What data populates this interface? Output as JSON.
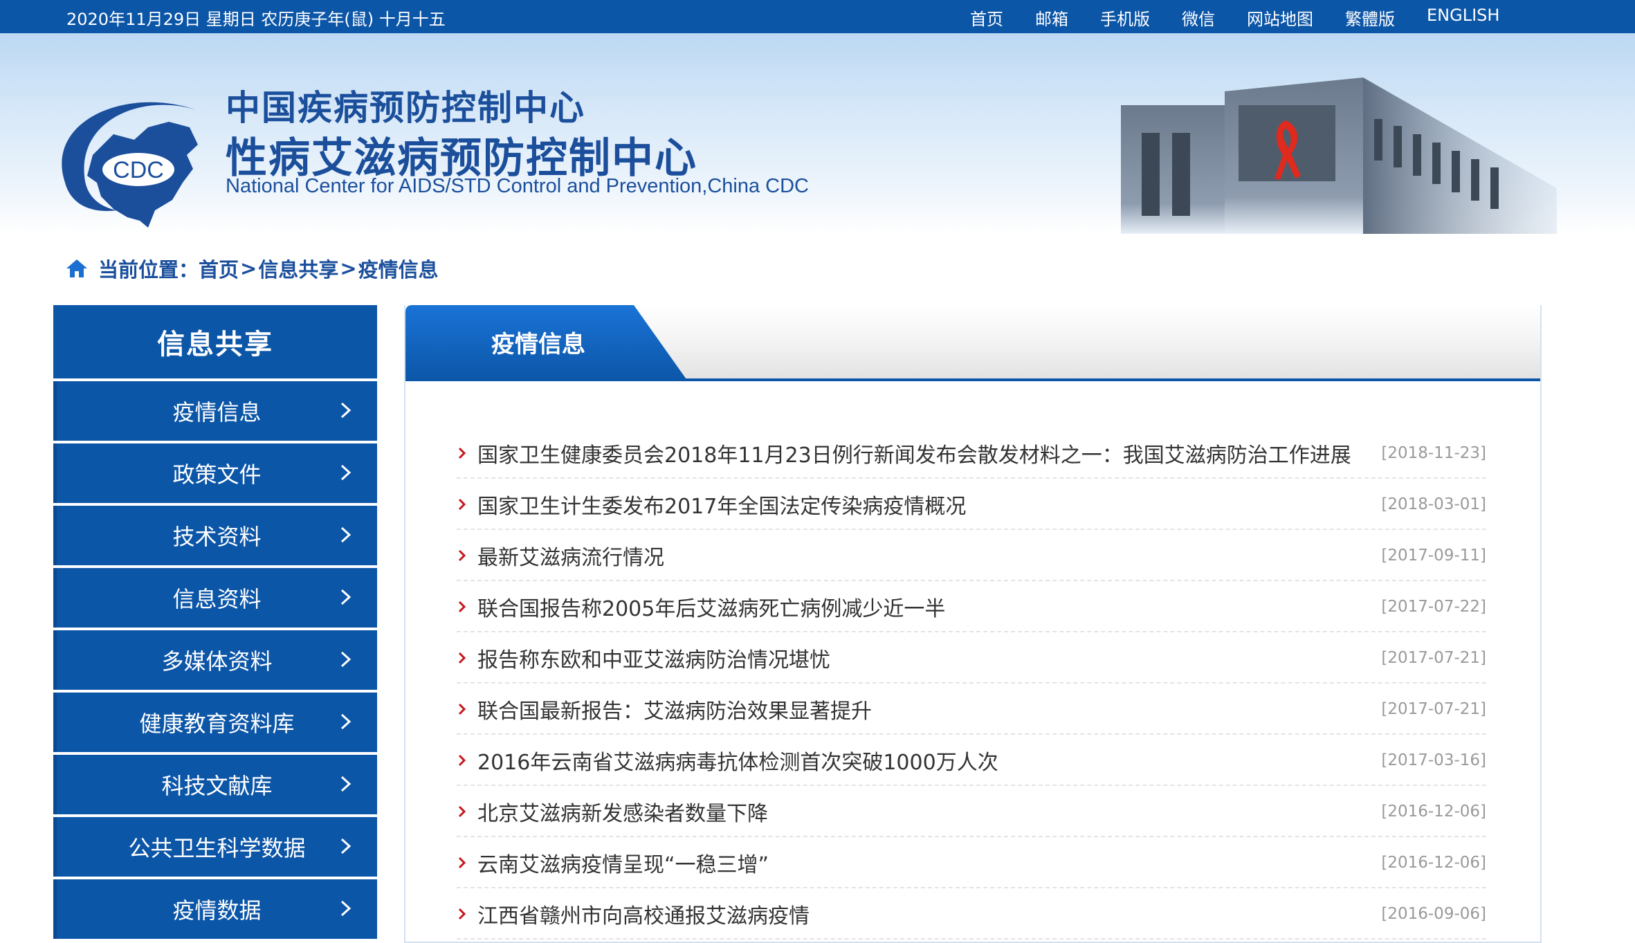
{
  "topbar": {
    "date_text": "2020年11月29日 星期日  农历庚子年(鼠) 十月十五",
    "links": [
      "首页",
      "邮箱",
      "手机版",
      "微信",
      "网站地图",
      "繁體版",
      "ENGLISH"
    ]
  },
  "header": {
    "logo_text": "CDC",
    "title_cn_line1": "中国疾病预防控制中心",
    "title_cn_line2": "性病艾滋病预防控制中心",
    "title_en": "National Center for AIDS/STD Control and Prevention,China CDC"
  },
  "breadcrumb": {
    "prefix": "当前位置：",
    "items": [
      "首页",
      "信息共享",
      "疫情信息"
    ],
    "separator": ">"
  },
  "sidebar": {
    "title": "信息共享",
    "items": [
      {
        "label": "疫情信息"
      },
      {
        "label": "政策文件"
      },
      {
        "label": "技术资料"
      },
      {
        "label": "信息资料"
      },
      {
        "label": "多媒体资料"
      },
      {
        "label": "健康教育资料库"
      },
      {
        "label": "科技文献库"
      },
      {
        "label": "公共卫生科学数据"
      },
      {
        "label": "疫情数据"
      }
    ]
  },
  "main": {
    "tab_title": "疫情信息",
    "articles": [
      {
        "title": "国家卫生健康委员会2018年11月23日例行新闻发布会散发材料之一：我国艾滋病防治工作进展",
        "date": "[2018-11-23]"
      },
      {
        "title": "国家卫生计生委发布2017年全国法定传染病疫情概况",
        "date": "[2018-03-01]"
      },
      {
        "title": "最新艾滋病流行情况",
        "date": "[2017-09-11]"
      },
      {
        "title": "联合国报告称2005年后艾滋病死亡病例减少近一半",
        "date": "[2017-07-22]"
      },
      {
        "title": "报告称东欧和中亚艾滋病防治情况堪忧",
        "date": "[2017-07-21]"
      },
      {
        "title": "联合国最新报告：艾滋病防治效果显著提升",
        "date": "[2017-07-21]"
      },
      {
        "title": "2016年云南省艾滋病病毒抗体检测首次突破1000万人次",
        "date": "[2017-03-16]"
      },
      {
        "title": "北京艾滋病新发感染者数量下降",
        "date": "[2016-12-06]"
      },
      {
        "title": "云南艾滋病疫情呈现“一稳三增”",
        "date": "[2016-12-06]"
      },
      {
        "title": "江西省赣州市向高校通报艾滋病疫情",
        "date": "[2016-09-06]"
      }
    ]
  },
  "colors": {
    "brand_blue": "#0c56a8",
    "title_blue": "#1b4f9c",
    "arrow_red": "#c8161d",
    "date_gray": "#999999"
  }
}
